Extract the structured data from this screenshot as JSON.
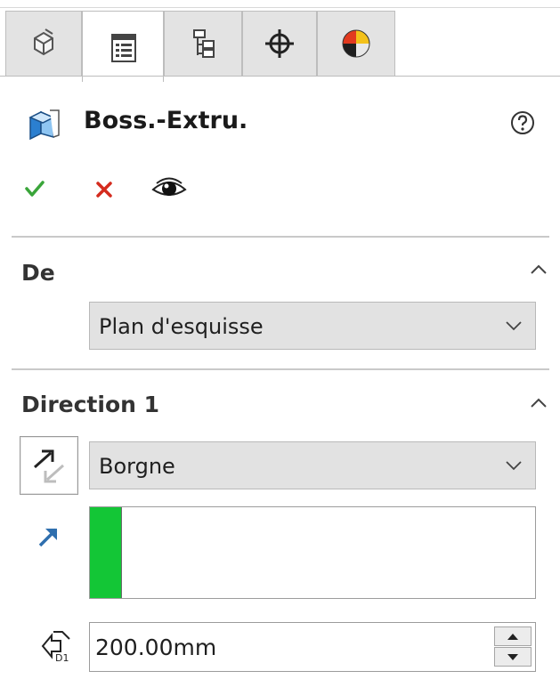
{
  "tabs": [
    {
      "icon": "feature-manager-icon",
      "active": false
    },
    {
      "icon": "property-manager-icon",
      "active": true
    },
    {
      "icon": "configuration-manager-icon",
      "active": false
    },
    {
      "icon": "dimxpert-target-icon",
      "active": false
    },
    {
      "icon": "display-manager-icon",
      "active": false
    }
  ],
  "header": {
    "icon": "extrude-feature-icon",
    "title": "Boss.-Extru.",
    "help_icon": "help-icon"
  },
  "actions": {
    "ok_icon": "checkmark-icon",
    "cancel_icon": "close-icon",
    "preview_icon": "eye-icon"
  },
  "from_group": {
    "title": "De",
    "start_condition": "Plan d'esquisse"
  },
  "direction1_group": {
    "title": "Direction 1",
    "end_condition": "Borgne",
    "depth_value": "200.00mm"
  },
  "colors": {
    "ok_green": "#3aa53a",
    "cancel_red": "#d42b1e",
    "selection_green": "#13c636",
    "direction_blue": "#2f6fae"
  }
}
